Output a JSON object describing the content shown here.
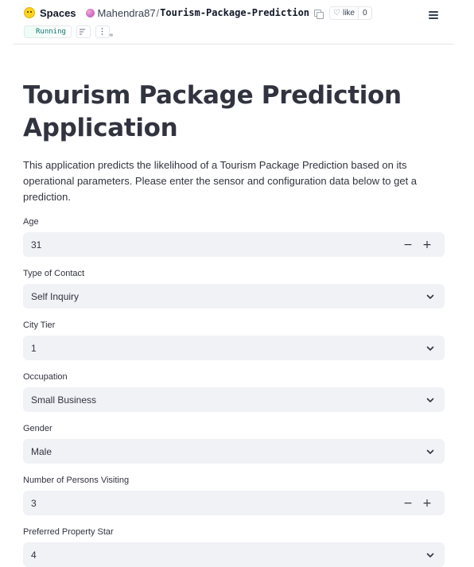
{
  "header": {
    "spaces_label": "Spaces",
    "owner": "Mahendra87",
    "separator": "/",
    "repo": "Tourism-Package-Prediction",
    "like_label": "like",
    "like_count": "0",
    "status": "Running",
    "icons": {
      "logo": "hugging-face-logo-icon",
      "copy": "copy-icon",
      "heart": "heart-icon",
      "menu": "hamburger-menu-icon",
      "logs": "logs-icon",
      "more": "more-vertical-icon",
      "link": "link-icon"
    }
  },
  "app": {
    "title": "Tourism Package Prediction Application",
    "description": "This application predicts the likelihood of a Tourism Package Prediction based on its operational parameters. Please enter the sensor and configuration data below to get a prediction.",
    "fields": [
      {
        "label": "Age",
        "value": "31",
        "kind": "number"
      },
      {
        "label": "Type of Contact",
        "value": "Self Inquiry",
        "kind": "select"
      },
      {
        "label": "City Tier",
        "value": "1",
        "kind": "select"
      },
      {
        "label": "Occupation",
        "value": "Small Business",
        "kind": "select"
      },
      {
        "label": "Gender",
        "value": "Male",
        "kind": "select"
      },
      {
        "label": "Number of Persons Visiting",
        "value": "3",
        "kind": "number"
      },
      {
        "label": "Preferred Property Star",
        "value": "4",
        "kind": "select"
      }
    ],
    "stepper": {
      "minus": "−",
      "plus": "+"
    }
  },
  "colors": {
    "input_bg": "#f0f2f6",
    "text": "#31333f",
    "status_green": "#0f766e"
  }
}
